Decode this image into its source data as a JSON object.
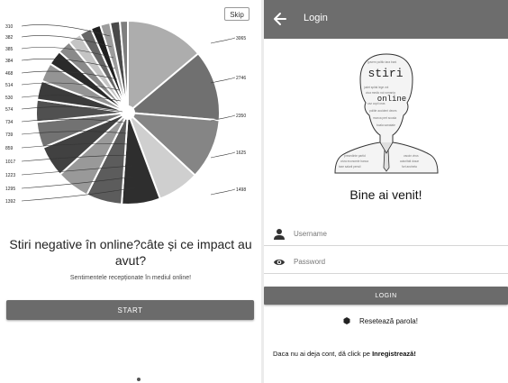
{
  "intro": {
    "skip_label": "Skip",
    "title": "Stiri negative în online?câte și ce impact au avut?",
    "subtitle": "Sentimentele recepționate în mediul online!",
    "start_label": "START"
  },
  "chart_data": {
    "type": "pie",
    "title": "",
    "values": [
      3065,
      2746,
      2350,
      1625,
      1498,
      1392,
      1295,
      1223,
      1017,
      859,
      739,
      734,
      574,
      530,
      514,
      468,
      384,
      385,
      382,
      310
    ],
    "colors": [
      "#adadad",
      "#707070",
      "#858585",
      "#cfcfcf",
      "#2e2e2e",
      "#5c5c5c",
      "#999999",
      "#414141",
      "#727272",
      "#505050",
      "#3b3b3b",
      "#949494",
      "#2a2a2a",
      "#8a8a8a",
      "#c4c4c4",
      "#666666",
      "#202020",
      "#9c9c9c",
      "#4a4a4a",
      "#7e7e7e"
    ],
    "labels_right": [
      "3065",
      "2746",
      "2350",
      "1625",
      "1498"
    ],
    "labels_left": [
      "310",
      "382",
      "385",
      "384",
      "468",
      "514",
      "530",
      "574",
      "734",
      "739",
      "859",
      "1017",
      "1223",
      "1295",
      "1392"
    ]
  },
  "login": {
    "appbar_title": "Login",
    "welcome": "Bine ai venit!",
    "username_placeholder": "Username",
    "password_placeholder": "Password",
    "login_label": "LOGIN",
    "reset_label": "Resetează parola!",
    "register_prefix": "Daca nu ai deja cont, dă click pe ",
    "register_link": "Inregistrează!",
    "cloud_words": [
      "stiri",
      "online"
    ]
  },
  "icons": {
    "back": "arrow-left-icon",
    "user": "person-icon",
    "password": "eye-icon",
    "reset": "gear-icon"
  }
}
